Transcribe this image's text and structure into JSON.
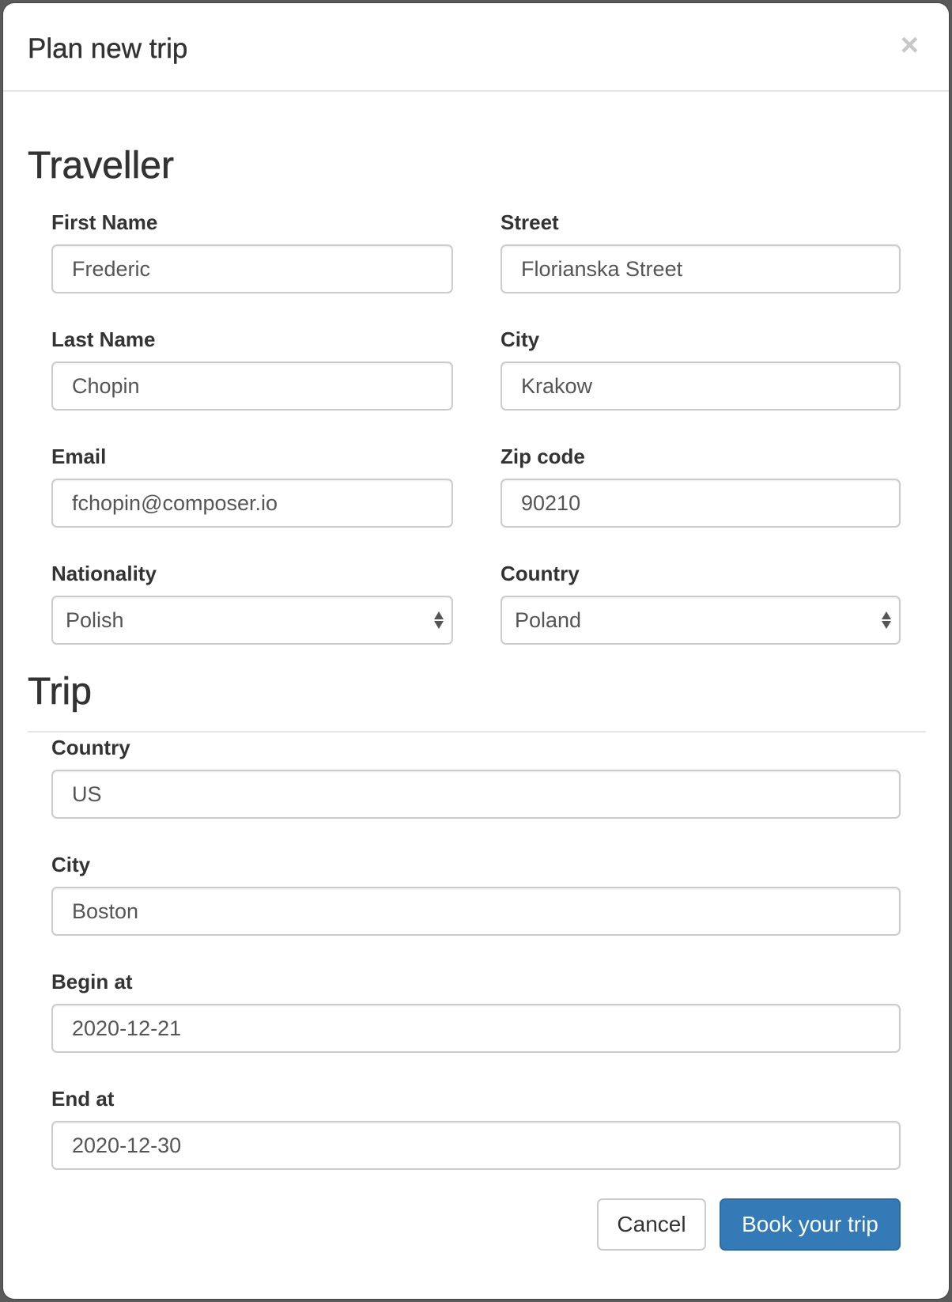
{
  "modal": {
    "title": "Plan new trip",
    "close_glyph": "×",
    "close_icon": "close-icon"
  },
  "traveller": {
    "heading": "Traveller",
    "first_name": {
      "label": "First Name",
      "value": "Frederic"
    },
    "last_name": {
      "label": "Last Name",
      "value": "Chopin"
    },
    "email": {
      "label": "Email",
      "value": "fchopin@composer.io"
    },
    "nationality": {
      "label": "Nationality",
      "value": "Polish"
    },
    "street": {
      "label": "Street",
      "value": "Florianska Street"
    },
    "city": {
      "label": "City",
      "value": "Krakow"
    },
    "zip": {
      "label": "Zip code",
      "value": "90210"
    },
    "country": {
      "label": "Country",
      "value": "Poland"
    }
  },
  "trip": {
    "heading": "Trip",
    "country": {
      "label": "Country",
      "value": "US"
    },
    "city": {
      "label": "City",
      "value": "Boston"
    },
    "begin_at": {
      "label": "Begin at",
      "value": "2020-12-21"
    },
    "end_at": {
      "label": "End at",
      "value": "2020-12-30"
    }
  },
  "footer": {
    "cancel_label": "Cancel",
    "submit_label": "Book your trip"
  },
  "colors": {
    "primary": "#337ab7",
    "backdrop": "#5a5a5a"
  }
}
